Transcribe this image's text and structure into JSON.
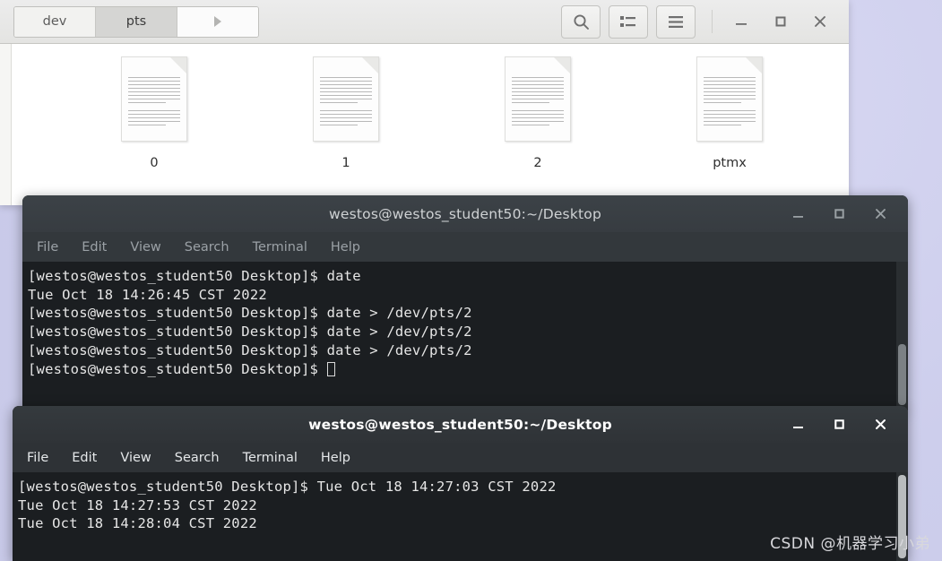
{
  "desktop": {
    "background_color": "#cfd0ee",
    "watermark": "CSDN @机器学习小弟"
  },
  "file_manager": {
    "breadcrumb": {
      "items": [
        {
          "label": "dev",
          "active": false
        },
        {
          "label": "pts",
          "active": true
        }
      ],
      "forward_arrow_icon": "triangle-right-icon"
    },
    "toolbar": [
      {
        "name": "search-button",
        "icon": "search-icon"
      },
      {
        "name": "view-list-button",
        "icon": "list-view-icon"
      },
      {
        "name": "menu-button",
        "icon": "hamburger-menu-icon"
      }
    ],
    "window_controls": [
      {
        "name": "minimize-button",
        "icon": "minimize-icon"
      },
      {
        "name": "maximize-button",
        "icon": "maximize-icon"
      },
      {
        "name": "close-button",
        "icon": "close-icon"
      }
    ],
    "files": [
      {
        "label": "0",
        "icon": "document-icon"
      },
      {
        "label": "1",
        "icon": "document-icon"
      },
      {
        "label": "2",
        "icon": "document-icon"
      },
      {
        "label": "ptmx",
        "icon": "document-icon"
      }
    ]
  },
  "terminal_1": {
    "title": "westos@westos_student50:~/Desktop",
    "focused": false,
    "menus": [
      "File",
      "Edit",
      "View",
      "Search",
      "Terminal",
      "Help"
    ],
    "window_controls": [
      {
        "name": "minimize-button",
        "icon": "minimize-icon"
      },
      {
        "name": "maximize-button",
        "icon": "maximize-icon"
      },
      {
        "name": "close-button",
        "icon": "close-icon"
      }
    ],
    "lines": [
      "[westos@westos_student50 Desktop]$ date",
      "Tue Oct 18 14:26:45 CST 2022",
      "[westos@westos_student50 Desktop]$ date > /dev/pts/2",
      "[westos@westos_student50 Desktop]$ date > /dev/pts/2",
      "[westos@westos_student50 Desktop]$ date > /dev/pts/2"
    ],
    "prompt": "[westos@westos_student50 Desktop]$ "
  },
  "terminal_2": {
    "title": "westos@westos_student50:~/Desktop",
    "focused": true,
    "menus": [
      "File",
      "Edit",
      "View",
      "Search",
      "Terminal",
      "Help"
    ],
    "window_controls": [
      {
        "name": "minimize-button",
        "icon": "minimize-icon"
      },
      {
        "name": "maximize-button",
        "icon": "maximize-icon"
      },
      {
        "name": "close-button",
        "icon": "close-icon"
      }
    ],
    "lines": [
      "[westos@westos_student50 Desktop]$ Tue Oct 18 14:27:03 CST 2022",
      "Tue Oct 18 14:27:53 CST 2022",
      "Tue Oct 18 14:28:04 CST 2022"
    ]
  }
}
